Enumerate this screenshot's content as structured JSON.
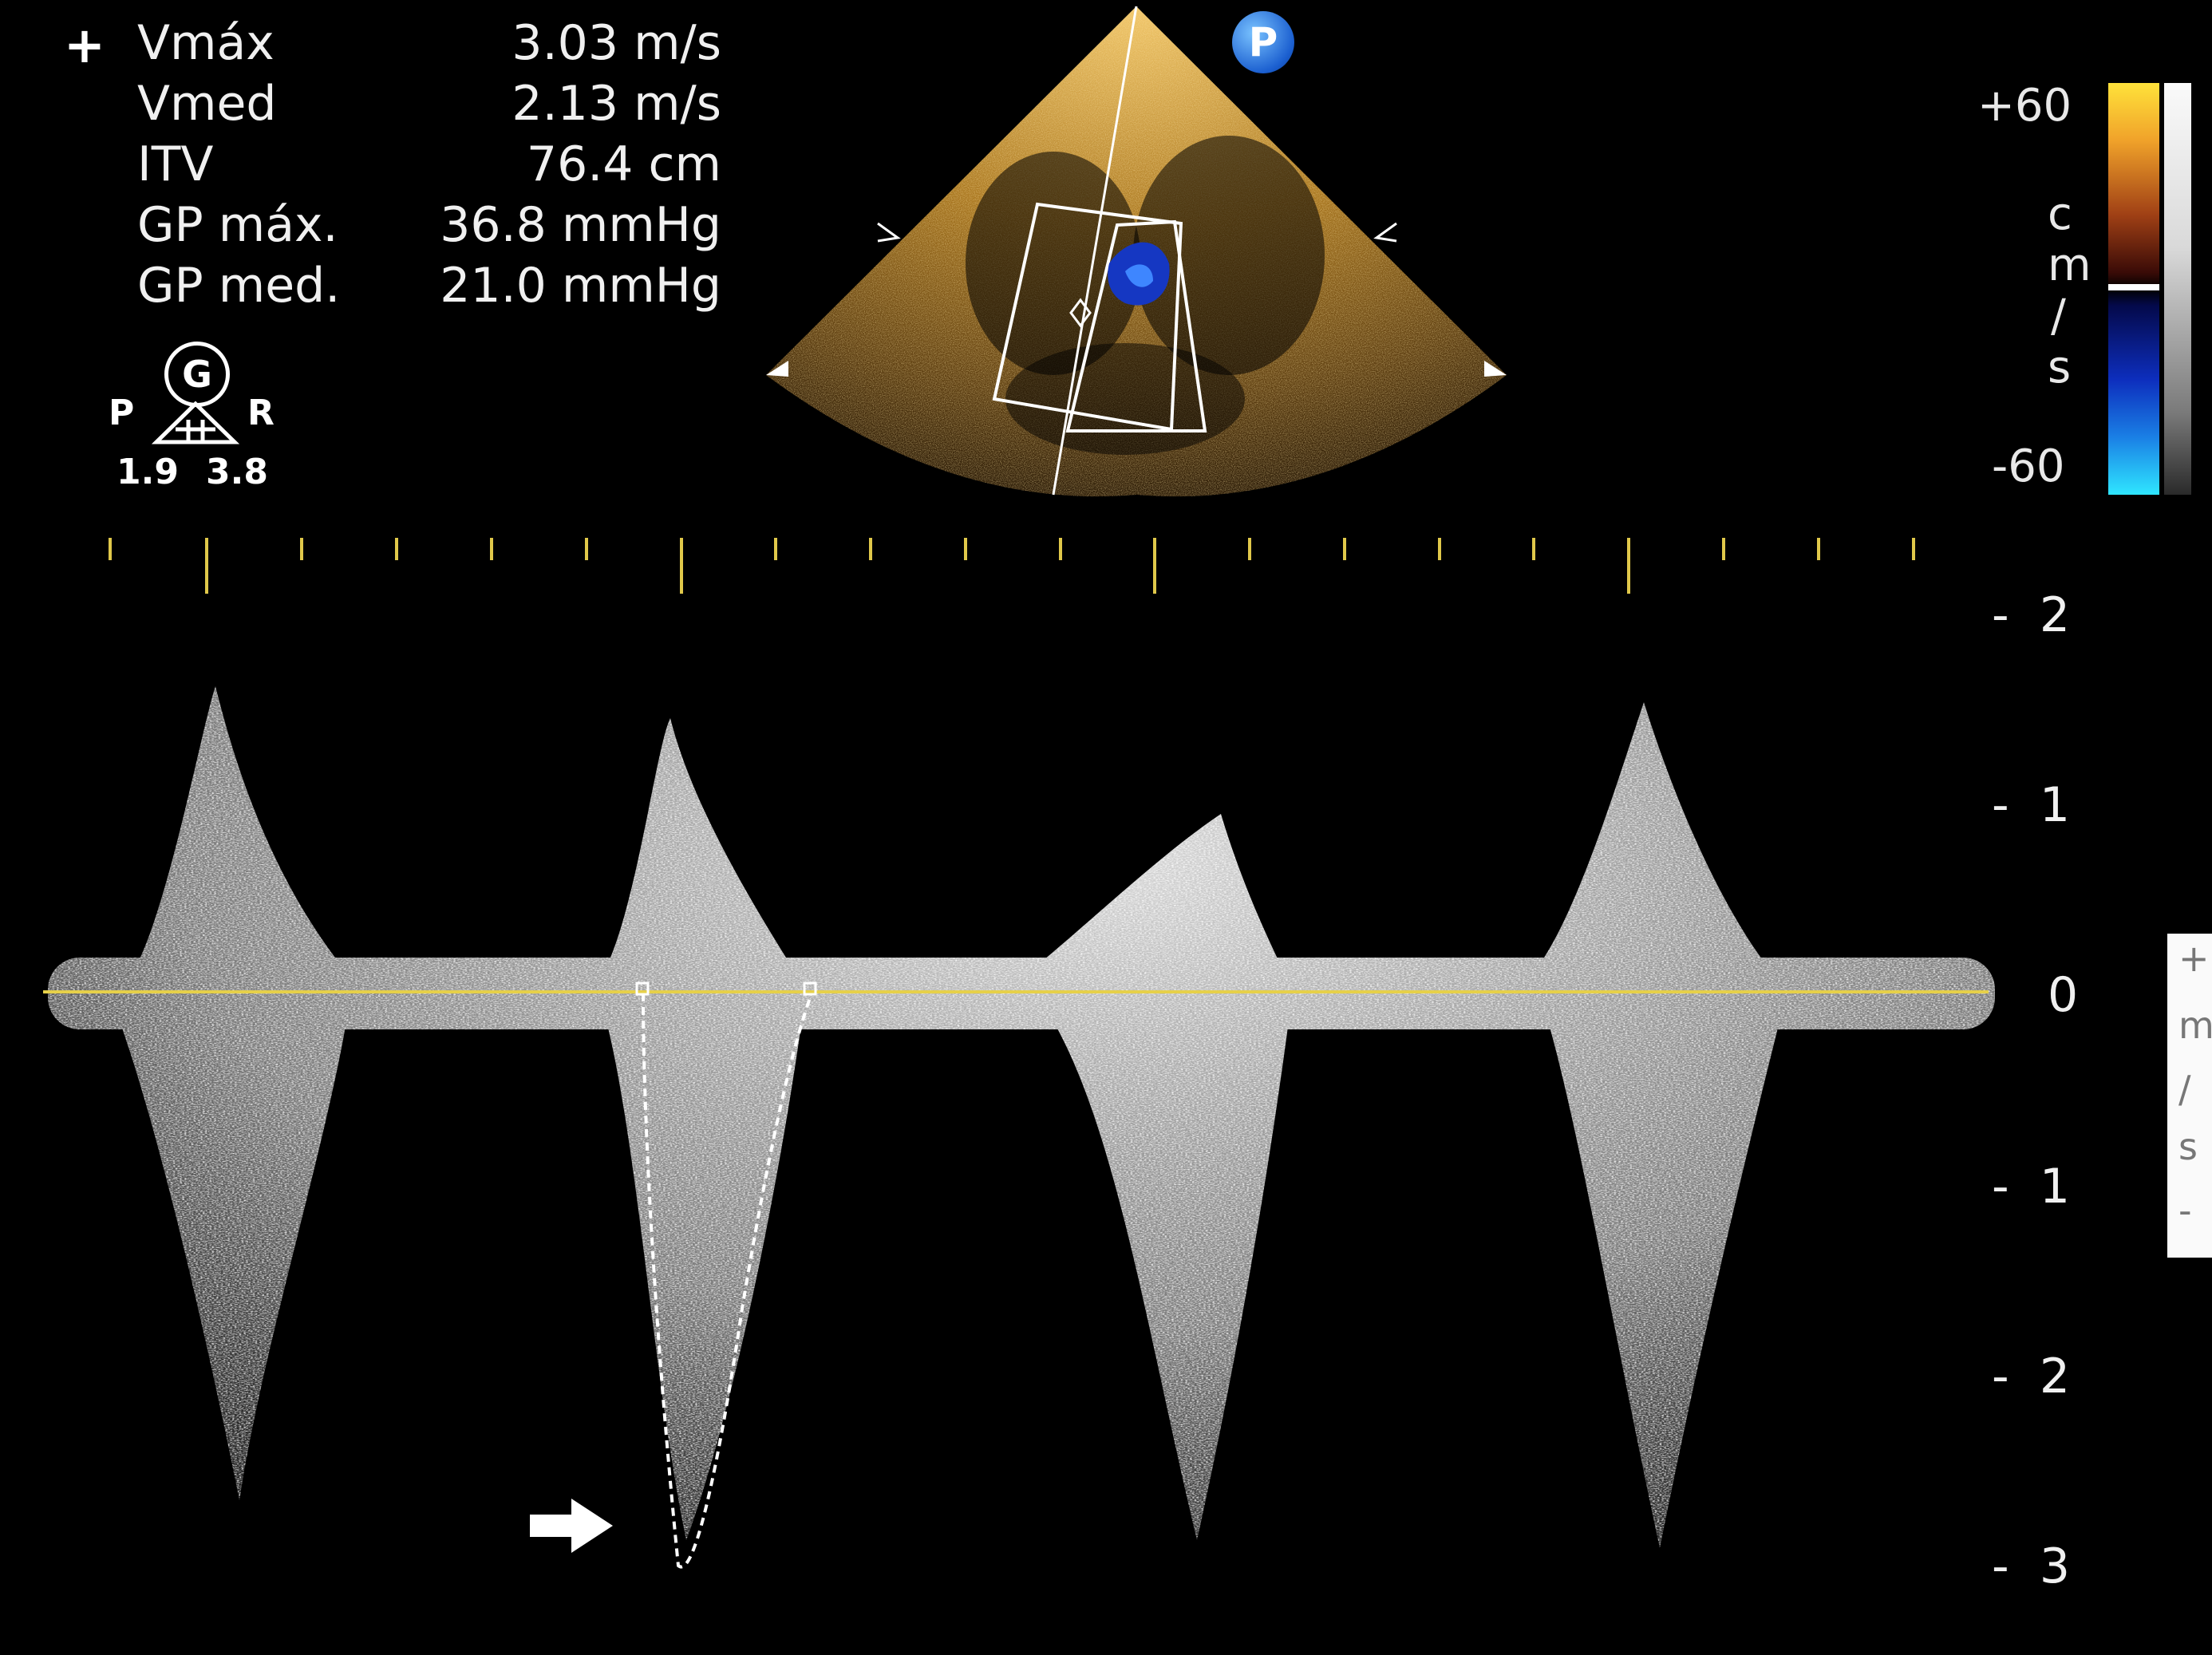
{
  "measurements": {
    "marker": "+",
    "items": [
      {
        "label": "Vmáx",
        "value": "3.03 m/s"
      },
      {
        "label": "Vmed",
        "value": "2.13 m/s"
      },
      {
        "label": "ITV",
        "value": "76.4 cm"
      },
      {
        "label": "GP máx.",
        "value": "36.8 mmHg"
      },
      {
        "label": "GP med.",
        "value": "21.0 mmHg"
      }
    ]
  },
  "orientation": {
    "g_symbol": "G",
    "left": "P",
    "right": "R",
    "value_left": "1.9",
    "value_right": "3.8"
  },
  "probe_badge": "P",
  "color_scale": {
    "top": "+60",
    "bottom": "-60",
    "unit_chars": [
      "c",
      "m",
      "/",
      "s"
    ]
  },
  "doppler_axis": {
    "ticks": [
      {
        "value": "2",
        "prefix": "-"
      },
      {
        "value": "1",
        "prefix": "-"
      },
      {
        "value": "0",
        "prefix": ""
      },
      {
        "value": "1",
        "prefix": "-"
      },
      {
        "value": "2",
        "prefix": "-"
      },
      {
        "value": "3",
        "prefix": "-"
      }
    ],
    "side_unit": [
      "+",
      "m",
      "/",
      "s",
      "-"
    ]
  },
  "colors": {
    "baseline": "#e6d04a",
    "timing_ticks": "#e0c84a",
    "sector_gold": "#c8932a",
    "signal": "#ffffff",
    "background": "#000000"
  }
}
